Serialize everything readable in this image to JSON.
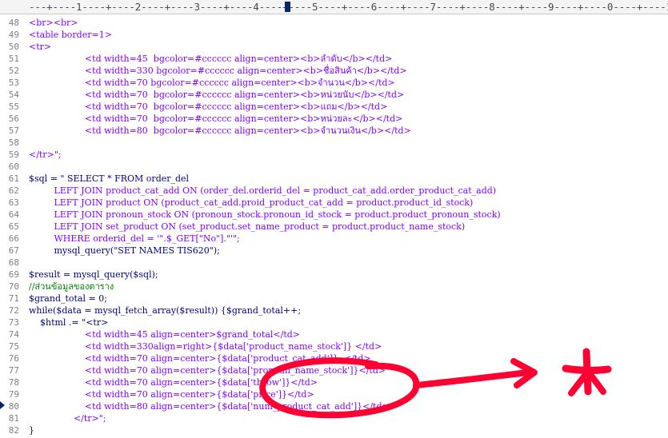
{
  "ruler": {
    "text": "---+----1----+----2----+----3----+----4----+----5----+----6----+----7----+----8----+----9----+----0----+----1"
  },
  "lines": [
    {
      "num": "48",
      "text": "<br><br>",
      "color": "html"
    },
    {
      "num": "49",
      "text": "<table border=1>",
      "color": "html"
    },
    {
      "num": "50",
      "text": "<tr>",
      "color": "html"
    },
    {
      "num": "51",
      "text": "                    <td width=45  bgcolor=#cccccc align=center><b>ลำดับ</b></td>",
      "color": "html"
    },
    {
      "num": "52",
      "text": "                    <td width=330 bgcolor=#cccccc align=center><b>ชื่อสินค้า</b></td>",
      "color": "html"
    },
    {
      "num": "53",
      "text": "                    <td width=70 bgcolor=#cccccc align=center><b>จำนวน</b></td>",
      "color": "html"
    },
    {
      "num": "54",
      "text": "                    <td width=70  bgcolor=#cccccc align=center><b>หน่วยนับ</b></td>",
      "color": "html"
    },
    {
      "num": "55",
      "text": "                    <td width=70  bgcolor=#cccccc align=center><b>แถม</b></td>",
      "color": "html"
    },
    {
      "num": "56",
      "text": "                    <td width=70  bgcolor=#cccccc align=center><b>หน่วยละ</b></td>",
      "color": "html"
    },
    {
      "num": "57",
      "text": "                    <td width=80  bgcolor=#cccccc align=center><b>จำนวนเงิน</b></td>",
      "color": "html"
    },
    {
      "num": "58",
      "text": "",
      "color": "html"
    },
    {
      "num": "59",
      "text": "</tr>\";",
      "color": "html"
    },
    {
      "num": "60",
      "text": "",
      "color": "html"
    },
    {
      "num": "61",
      "text": "$sql = \" SELECT * FROM order_del",
      "color": "sql"
    },
    {
      "num": "62",
      "text": "         LEFT JOIN product_cat_add ON (order_del.orderid_del = product_cat_add.order_product_cat_add)",
      "color": "str"
    },
    {
      "num": "63",
      "text": "         LEFT JOIN product ON (product_cat_add.proid_product_cat_add = product.product_id_stock)",
      "color": "str"
    },
    {
      "num": "64",
      "text": "         LEFT JOIN pronoun_stock ON (pronoun_stock.pronoun_id_stock = product.product_pronoun_stock)",
      "color": "str"
    },
    {
      "num": "65",
      "text": "         LEFT JOIN set_product ON (set_product.set_name_product = product.product_name_stock)",
      "color": "str"
    },
    {
      "num": "66",
      "text": "         WHERE orderid_del = '\".$_GET[\"No\"].\"'\";",
      "color": "str"
    },
    {
      "num": "67",
      "text": "         mysql_query(\"SET NAMES TIS620\");",
      "color": "php"
    },
    {
      "num": "68",
      "text": "",
      "color": "php"
    },
    {
      "num": "69",
      "text": "$result = mysql_query($sql);",
      "color": "php"
    },
    {
      "num": "70",
      "text": "//ส่วนข้อมูลของตาราง",
      "color": "cmt"
    },
    {
      "num": "71",
      "text": "$grand_total = 0;",
      "color": "php"
    },
    {
      "num": "72",
      "text": "while($data = mysql_fetch_array($result)) {$grand_total++;",
      "color": "php"
    },
    {
      "num": "73",
      "text": "    $html .= \"<tr>",
      "color": "php"
    },
    {
      "num": "74",
      "text": "                    <td width=45 align=center>$grand_total</td>",
      "color": "html"
    },
    {
      "num": "75",
      "text": "                    <td width=330align=right>{$data['product_name_stock']} </td>",
      "color": "html"
    },
    {
      "num": "76",
      "text": "                    <td width=70 align=center>{$data['product_cat_add']}  </td>",
      "color": "html"
    },
    {
      "num": "77",
      "text": "                    <td width=70 align=center>{$data['pronoun_name_stock']}</td>",
      "color": "html"
    },
    {
      "num": "78",
      "text": "                    <td width=70 align=center>{$data['throw']}</td>",
      "color": "html"
    },
    {
      "num": "79",
      "text": "                    <td width=70 align=center>{$data['price']}</td>",
      "color": "html"
    },
    {
      "num": "80",
      "text": "                    <td width=80 align=center>{$data['num_product_cat_add']}</td>",
      "color": "html"
    },
    {
      "num": "81",
      "text": "                </tr>\";",
      "color": "html"
    },
    {
      "num": "82",
      "text": "}",
      "color": "php"
    }
  ],
  "colors": {
    "html": "#8000ff",
    "php": "#000080",
    "str": "#8000ff",
    "sql": "#000080",
    "cmt": "#008000",
    "annotation": "#ff0033"
  }
}
